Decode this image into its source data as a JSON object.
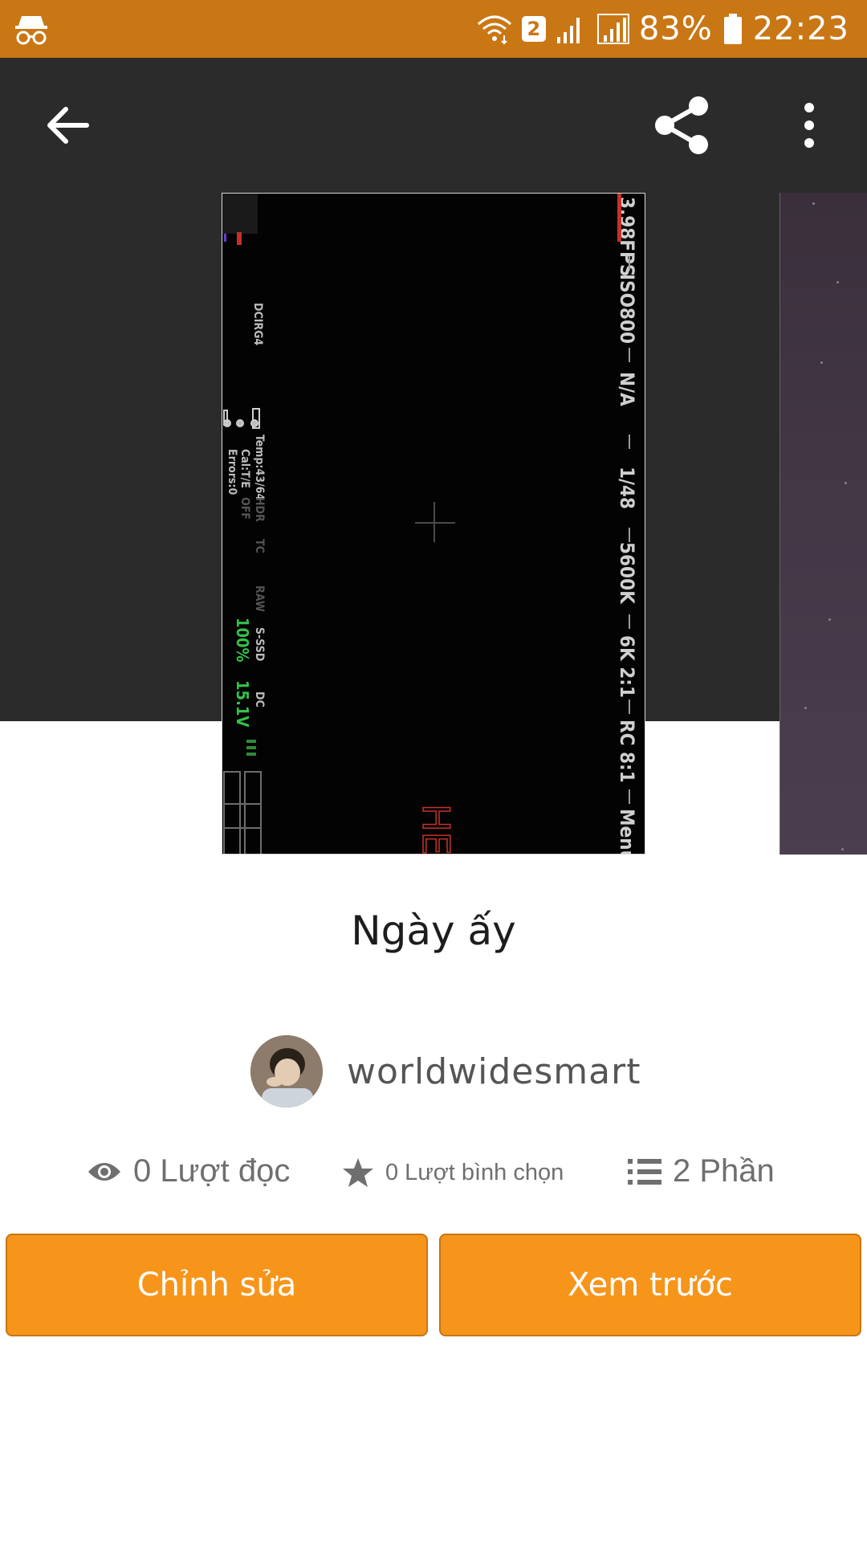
{
  "status_bar": {
    "sim_badge": "2",
    "battery_text": "83%",
    "time": "22:23",
    "icons": [
      "incognito-icon",
      "wifi-icon",
      "signal-icon",
      "battery-icon"
    ]
  },
  "toolbar": {
    "icons": [
      "back-arrow-icon",
      "share-icon",
      "more-vert-icon"
    ]
  },
  "cover_overlay": {
    "right_column": [
      "3.98FPS",
      "ISO800",
      "N/A",
      "1/48",
      "5600K",
      "6K 2:1",
      "RC 8:1",
      "Menu"
    ],
    "left_column": [
      "DCIRG4",
      "Temp:43/64",
      "Cal:T/E",
      "Errors:0",
      "HDR",
      "OFF",
      "TC",
      "RAW",
      "S-SSD",
      "100%",
      "DC",
      "15.1V"
    ],
    "bottom_fragment": "HEL"
  },
  "story": {
    "title": "Ngày ấy",
    "author": "worldwidesmart",
    "reads": "0 Lượt đọc",
    "votes": "0 Lượt bình chọn",
    "parts": "2 Phần"
  },
  "buttons": {
    "edit_label": "Chỉnh sửa",
    "preview_label": "Xem trước"
  },
  "colors": {
    "status_bar": "#c97714",
    "header": "#2b2b2b",
    "accent": "#f7951b",
    "accent_border": "#c77612"
  }
}
